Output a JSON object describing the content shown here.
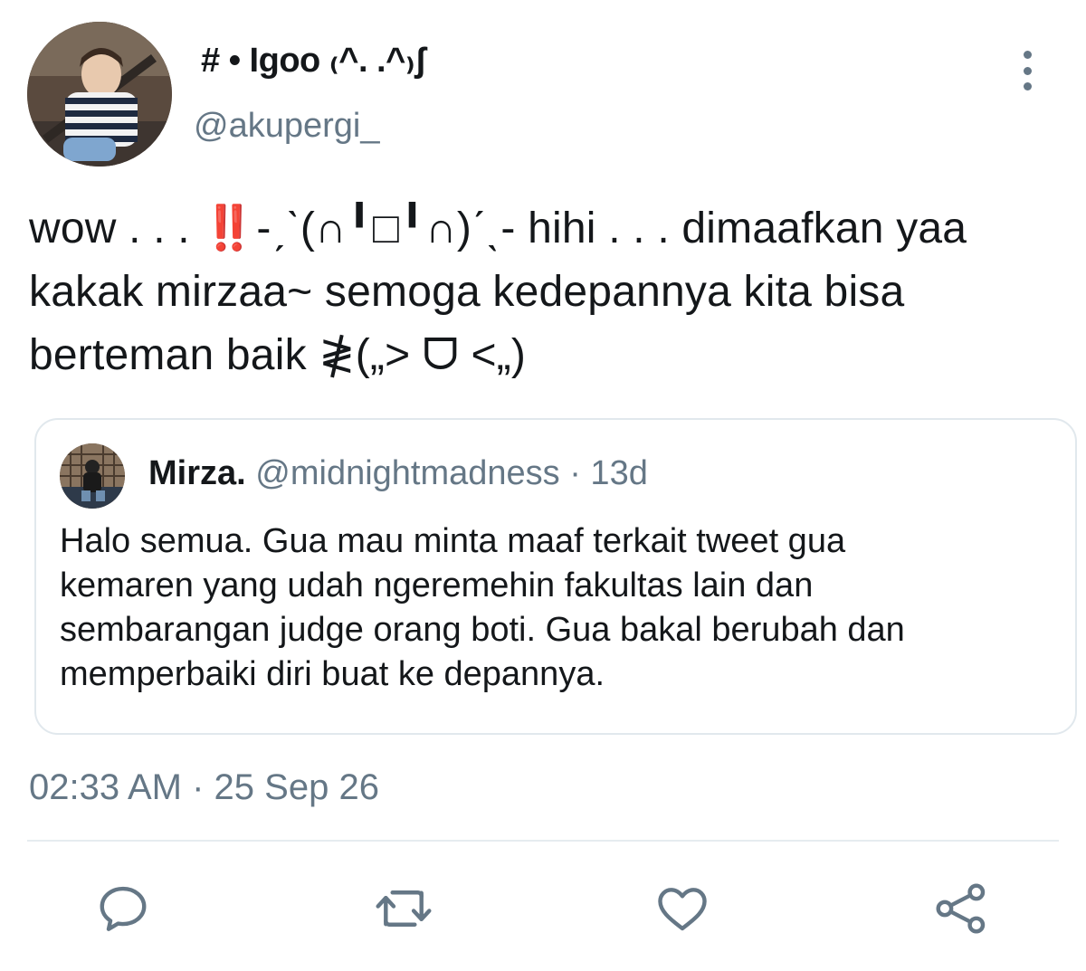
{
  "author": {
    "display_name": "# • Igoo ₍^. .^₎ʃ",
    "handle": "@akupergi_"
  },
  "tweet": {
    "text": "wow . . . ‼️-ˏˋ(∩╹□╹∩)ˊˎ- hihi . . . dimaafkan yaa\nkakak mirzaa~ semoga kedepannya kita bisa\nberteman baik ≹(„> ᗜ <„)",
    "timestamp": "02:33 AM · 25 Sep 26"
  },
  "quoted_tweet": {
    "name": "Mirza.",
    "meta": "@midnightmadness · 13d",
    "text": "Halo semua. Gua mau minta maaf terkait tweet gua\nkemaren yang udah ngeremehin fakultas lain dan\nsembarangan judge orang boti. Gua bakal berubah dan\nmemperbaiki diri buat ke depannya."
  },
  "actions": {
    "icons": [
      "reply-icon",
      "retweet-icon",
      "like-icon",
      "share-icon"
    ]
  },
  "colors": {
    "text_primary": "#14171a",
    "text_secondary": "#657786",
    "border": "#e1e8ed",
    "icon": "#657786"
  }
}
